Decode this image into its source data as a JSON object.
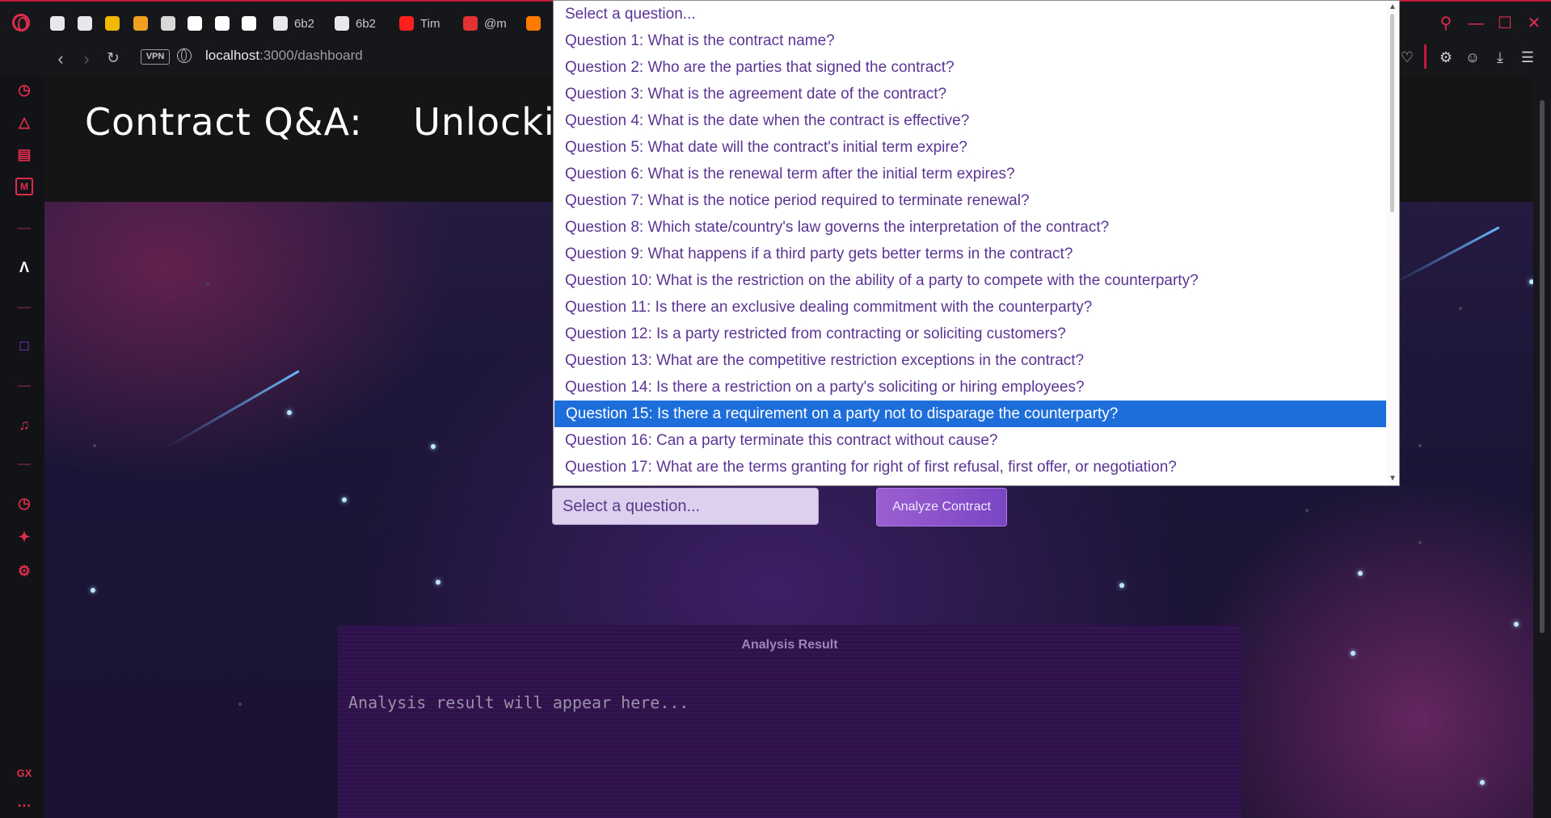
{
  "browser": {
    "tabs": [
      {
        "label": "",
        "icon": "gamepad-icon",
        "color": "#e8e8ea"
      },
      {
        "label": "",
        "icon": "openai-icon",
        "color": "#e8e8ea"
      },
      {
        "label": "",
        "icon": "bee-icon",
        "color": "#f1b800"
      },
      {
        "label": "",
        "icon": "lightning-icon",
        "color": "#f0a020"
      },
      {
        "label": "",
        "icon": "chrome-icon",
        "color": "#d8d8d8"
      },
      {
        "label": "",
        "icon": "notion-icon",
        "color": "#ffffff"
      },
      {
        "label": "",
        "icon": "github-icon",
        "color": "#ffffff"
      },
      {
        "label": "",
        "icon": "amazon-icon",
        "color": "#ffffff"
      },
      {
        "label": "6b2",
        "icon": "document-icon",
        "color": "#e8e8ea"
      },
      {
        "label": "6b2",
        "icon": "document-icon",
        "color": "#e8e8ea"
      },
      {
        "label": "Tim",
        "icon": "youtube-icon",
        "color": "#ff1f1f"
      },
      {
        "label": "@m",
        "icon": "n-icon",
        "color": "#e23232"
      },
      {
        "label": "",
        "icon": "f-icon",
        "color": "#ff7a00"
      }
    ],
    "vpn_label": "VPN",
    "url_host": "localhost",
    "url_path": ":3000/dashboard",
    "accent_color": "#e02c4c"
  },
  "page": {
    "title": "Contract Q&A:    Unlocking A",
    "select_value": "Select a question...",
    "analyze_label": "Analyze Contract",
    "result_title": "Analysis Result",
    "result_placeholder": "Analysis result will appear here..."
  },
  "dropdown": {
    "selected_index": 15,
    "selected_color": "#1d6ddb",
    "options": [
      "Select a question...",
      "Question 1: What is the contract name?",
      "Question 2: Who are the parties that signed the contract?",
      "Question 3: What is the agreement date of the contract?",
      "Question 4: What is the date when the contract is effective?",
      "Question 5: What date will the contract's initial term expire?",
      "Question 6: What is the renewal term after the initial term expires?",
      "Question 7: What is the notice period required to terminate renewal?",
      "Question 8: Which state/country's law governs the interpretation of the contract?",
      "Question 9: What happens if a third party gets better terms in the contract?",
      "Question 10: What is the restriction on the ability of a party to compete with the counterparty?",
      "Question 11: Is there an exclusive dealing commitment with the counterparty?",
      "Question 12: Is a party restricted from contracting or soliciting customers?",
      "Question 13: What are the competitive restriction exceptions in the contract?",
      "Question 14: Is there a restriction on a party's soliciting or hiring employees?",
      "Question 15: Is there a requirement on a party not to disparage the counterparty?",
      "Question 16: Can a party terminate this contract without cause?",
      "Question 17: What are the terms granting for right of first refusal, first offer, or negotiation?"
    ]
  },
  "sidebar": {
    "gx_label": "GX",
    "more_label": "…"
  }
}
